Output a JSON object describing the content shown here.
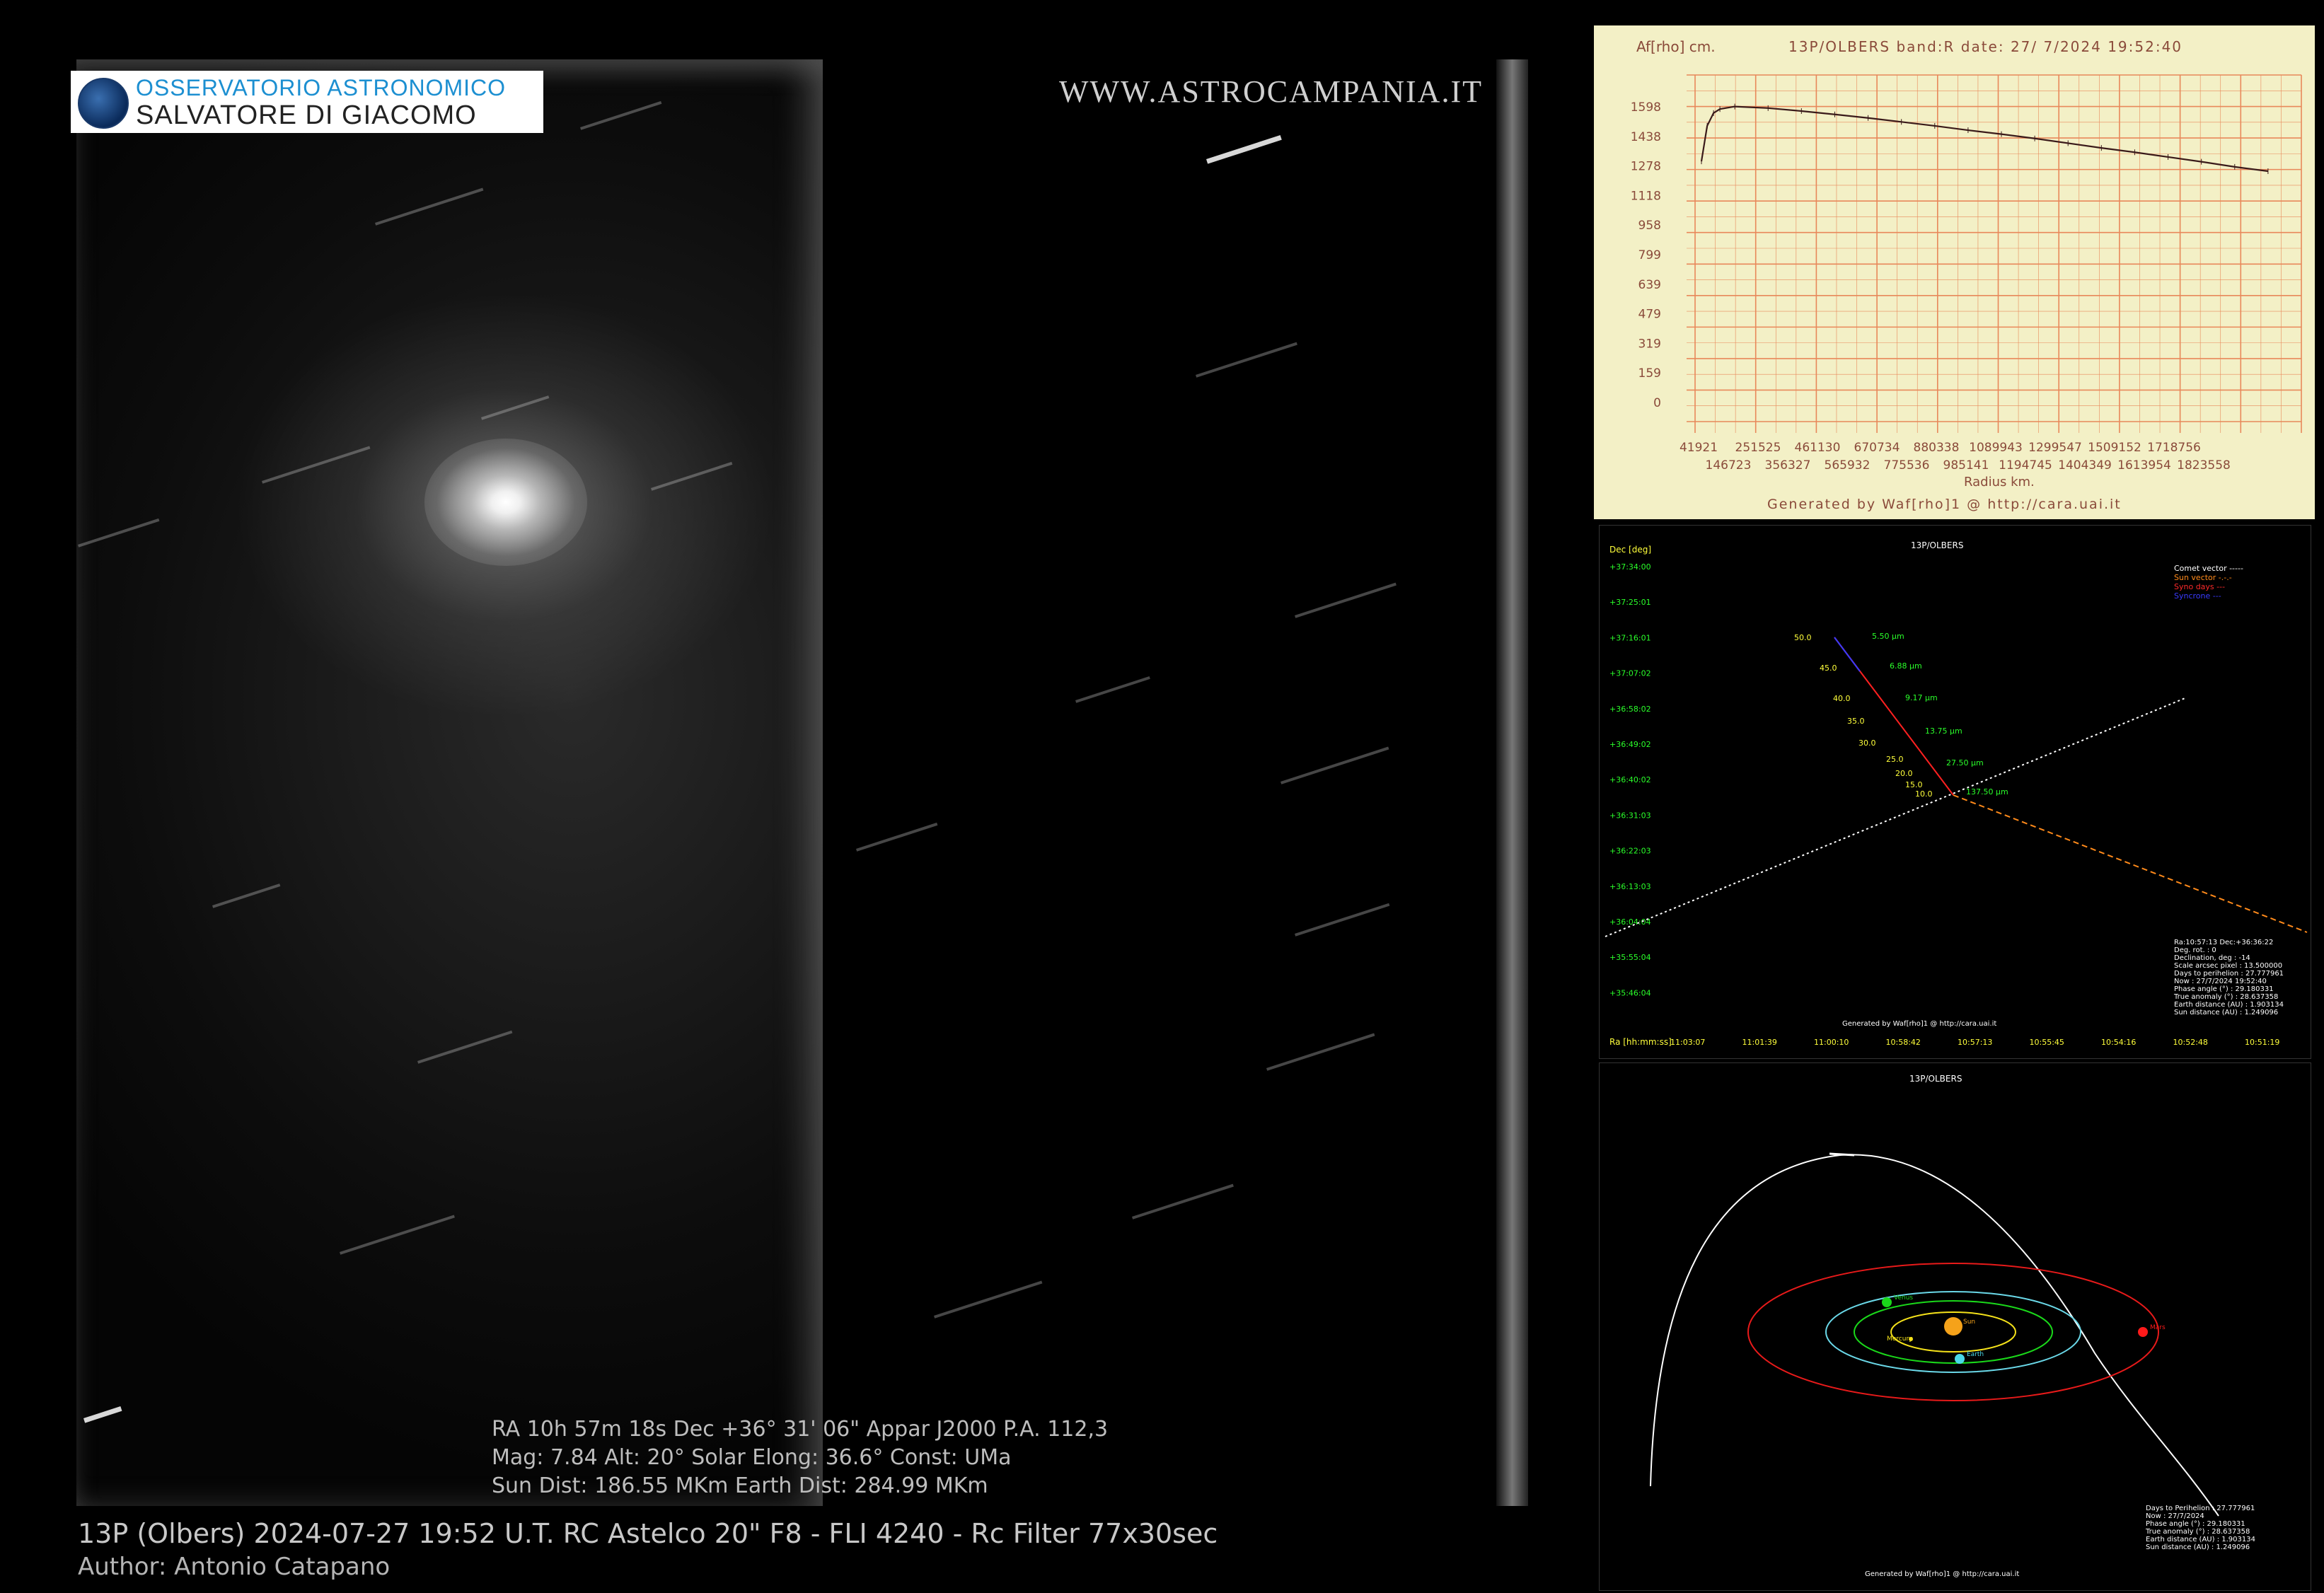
{
  "logo": {
    "line1": "OSSERVATORIO ASTRONOMICO",
    "line2": "SALVATORE DI GIACOMO"
  },
  "website": "WWW.ASTROCAMPANIA.IT",
  "overlay": {
    "line1": "RA 10h 57m 18s  Dec  +36° 31' 06\" Appar J2000 P.A. 112,3",
    "line2": "Mag: 7.84 Alt: 20° Solar Elong: 36.6° Const: UMa",
    "line3": "Sun Dist: 186.55 MKm   Earth Dist: 284.99 MKm"
  },
  "caption": {
    "title": "13P (Olbers)  2024-07-27  19:52 U.T.  RC Astelco 20\" F8 - FLI 4240 - Rc Filter 77x30sec",
    "author": "Author: Antonio Catapano"
  },
  "afrho_panel": {
    "ylabel": "Af[rho] cm.",
    "header": "13P/OLBERS band:R date: 27/ 7/2024 19:52:40",
    "yticks": [
      "1598",
      "1438",
      "1278",
      "1118",
      "958",
      "799",
      "639",
      "479",
      "319",
      "159",
      "0"
    ],
    "xticks_row1": [
      "41921",
      "251525",
      "461130",
      "670734",
      "880338",
      "1089943",
      "1299547",
      "1509152",
      "1718756"
    ],
    "xticks_row2": [
      "146723",
      "356327",
      "565932",
      "775536",
      "985141",
      "1194745",
      "1404349",
      "1613954",
      "1823558"
    ],
    "xlabel": "Radius km.",
    "footer": "Generated by Waf[rho]1 @ http://cara.uai.it",
    "ylim": [
      0,
      1758
    ],
    "xlim": [
      41921,
      1928360
    ],
    "curve_x": [
      41921,
      60000,
      80000,
      100000,
      146723,
      251525,
      356327,
      461130,
      565932,
      670734,
      775536,
      880338,
      985141,
      1089943,
      1194745,
      1299547,
      1404349,
      1509152,
      1613954,
      1718756,
      1823558
    ],
    "curve_y": [
      1320,
      1500,
      1565,
      1585,
      1598,
      1590,
      1575,
      1558,
      1540,
      1520,
      1500,
      1478,
      1458,
      1436,
      1412,
      1388,
      1366,
      1342,
      1318,
      1292,
      1270
    ],
    "colors": {
      "grid": "#e8885a",
      "curve": "#3a1a1a",
      "text": "#8a4a3a"
    }
  },
  "astrometry_panel": {
    "title": "13P/OLBERS",
    "dec_label": "Dec [deg]",
    "ra_label": "Ra [hh:mm:ss]",
    "dec_ticks": [
      "+37:34:00",
      "+37:25:01",
      "+37:16:01",
      "+37:07:02",
      "+36:58:02",
      "+36:49:02",
      "+36:40:02",
      "+36:31:03",
      "+36:22:03",
      "+36:13:03",
      "+36:04:04",
      "+35:55:04",
      "+35:46:04"
    ],
    "ra_ticks": [
      "11:03:07",
      "11:01:39",
      "11:00:10",
      "10:58:42",
      "10:57:13",
      "10:55:45",
      "10:54:16",
      "10:52:48",
      "10:51:19"
    ],
    "legend": [
      {
        "label": "Comet vector -----",
        "color": "#ffffff"
      },
      {
        "label": "Sun vector -.-.-",
        "color": "#ff8a1a"
      },
      {
        "label": "Syno days ---",
        "color": "#ff2a2a"
      },
      {
        "label": "Syncrone ---",
        "color": "#3a3aff"
      }
    ],
    "syno_labels": [
      "50.0",
      "45.0",
      "40.0",
      "35.0",
      "30.0",
      "25.0",
      "20.0",
      "15.0",
      "10.0"
    ],
    "size_labels": [
      "5.50 μm",
      "6.88 μm",
      "9.17 μm",
      "13.75 μm",
      "27.50 μm",
      "137.50 μm"
    ],
    "info": [
      "Ra:10:57:13 Dec:+36:36:22",
      "Deg. rot. :   0",
      "Declination, deg : -14",
      "Scale arcsec pixel : 13.500000",
      "Days to perihelion : 27.777961",
      "Now : 27/7/2024 19:52:40",
      "Phase angle (°) : 29.180331",
      "True anomaly (°) : 28.637358",
      "Earth distance (AU) : 1.903134",
      "Sun distance (AU) : 1.249096"
    ],
    "footer": "Generated by Waf[rho]1 @ http://cara.uai.it"
  },
  "orbit_panel": {
    "title": "13P/OLBERS",
    "planets": [
      {
        "name": "Sun",
        "color": "#f5a21a"
      },
      {
        "name": "Mercury",
        "color": "#f5e21a"
      },
      {
        "name": "Venus",
        "color": "#1ad81a"
      },
      {
        "name": "Earth",
        "color": "#4ad8e8"
      },
      {
        "name": "Mars",
        "color": "#ff1a1a"
      }
    ],
    "info": [
      "Days to Perihelion : 27.777961",
      "Now : 27/7/2024",
      "Phase angle (°) : 29.180331",
      "True anomaly (°) : 28.637358",
      "Earth distance (AU) : 1.903134",
      "Sun distance (AU) : 1.249096"
    ],
    "footer": "Generated by Waf[rho]1 @ http://cara.uai.it"
  }
}
